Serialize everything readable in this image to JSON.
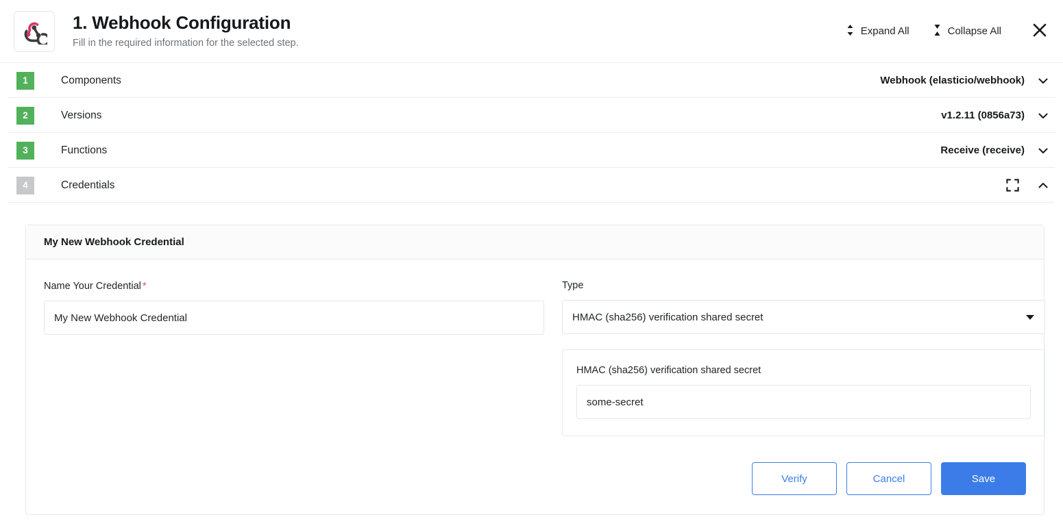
{
  "header": {
    "logo_icon": "webhook-logo-icon",
    "title": "1. Webhook Configuration",
    "subtitle": "Fill in the required information for the selected step.",
    "expand_all_label": "Expand All",
    "collapse_all_label": "Collapse All",
    "expand_all_icon": "chevron-up-down-icon",
    "collapse_all_icon": "collapse-arrows-icon",
    "close_icon": "close-icon"
  },
  "colors": {
    "accent_blue": "#3c7ce8",
    "step_green": "#52b15b",
    "step_grey": "#c6c8ca",
    "required_red": "#e8505b",
    "logo_pink": "#d7376a",
    "logo_dark": "#3c3c3c"
  },
  "steps": [
    {
      "number": "1",
      "label": "Components",
      "value": "Webhook (elasticio/webhook)",
      "badge_state": "green",
      "chevron_icon": "chevron-down-icon",
      "expanded": false
    },
    {
      "number": "2",
      "label": "Versions",
      "value": "v1.2.11 (0856a73)",
      "badge_state": "green",
      "chevron_icon": "chevron-down-icon",
      "expanded": false
    },
    {
      "number": "3",
      "label": "Functions",
      "value": "Receive (receive)",
      "badge_state": "green",
      "chevron_icon": "chevron-down-icon",
      "expanded": false
    },
    {
      "number": "4",
      "label": "Credentials",
      "value": "",
      "badge_state": "grey",
      "chevron_icon": "chevron-up-icon",
      "fullscreen_icon": "fullscreen-icon",
      "expanded": true
    }
  ],
  "credential_card": {
    "header_title": "My New Webhook Credential",
    "name_field": {
      "label": "Name Your Credential",
      "required_marker": "*",
      "value": "My New Webhook Credential",
      "placeholder": "Name Your Credential"
    },
    "type_field": {
      "label": "Type",
      "selected": "HMAC (sha256) verification shared secret",
      "caret_icon": "caret-down-icon"
    },
    "secret_panel": {
      "label": "HMAC (sha256) verification shared secret",
      "value": "some-secret",
      "placeholder": "HMAC (sha256) verification shared secret"
    },
    "buttons": {
      "verify": "Verify",
      "cancel": "Cancel",
      "save": "Save"
    }
  }
}
